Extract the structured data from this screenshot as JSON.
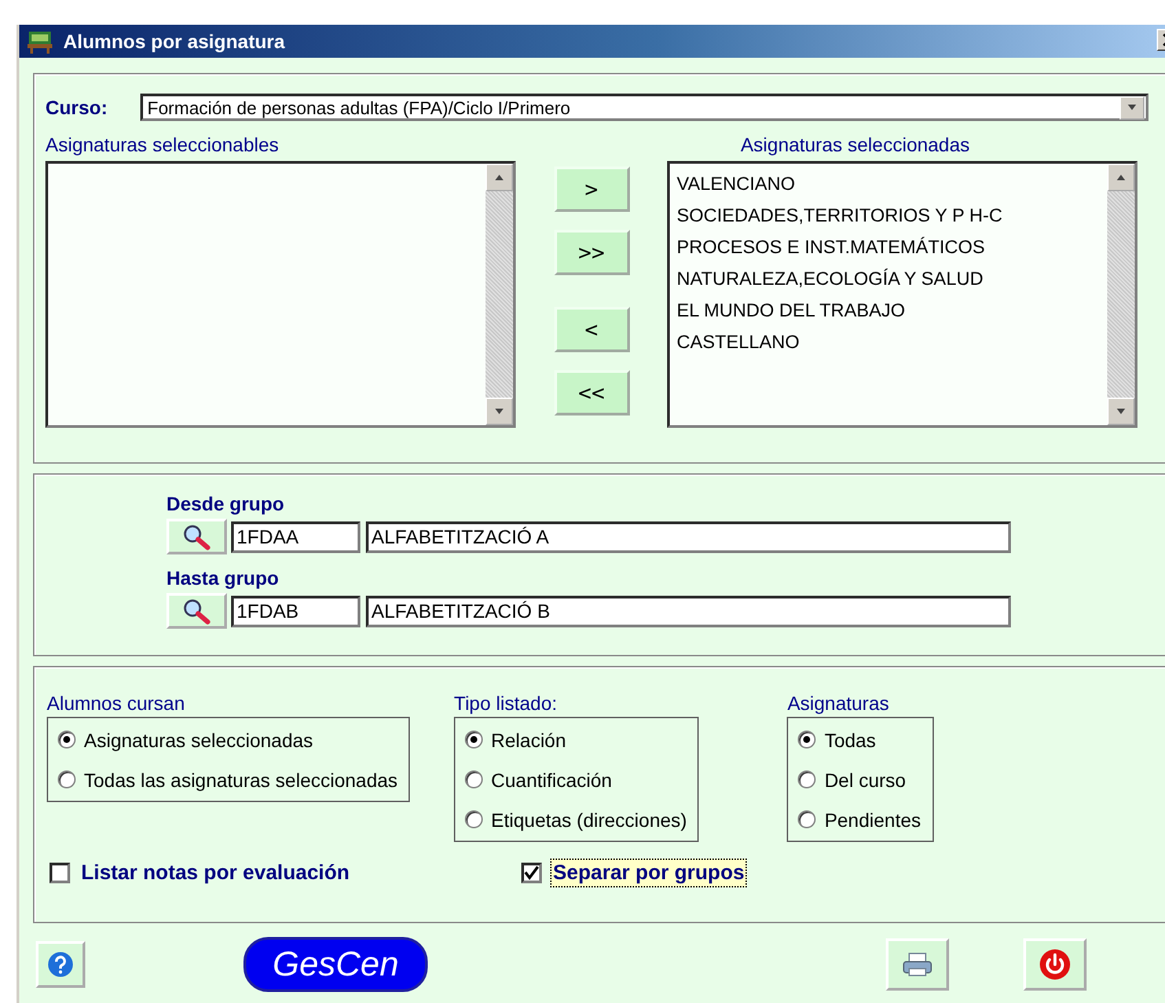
{
  "window": {
    "title": "Alumnos por asignatura"
  },
  "course": {
    "label": "Curso:",
    "value": "Formación de personas adultas (FPA)/Ciclo I/Primero"
  },
  "available": {
    "label": "Asignaturas seleccionables"
  },
  "selected_list": {
    "label": "Asignaturas seleccionadas",
    "items": [
      "VALENCIANO",
      "SOCIEDADES,TERRITORIOS Y P H-C",
      "PROCESOS E INST.MATEMÁTICOS",
      "NATURALEZA,ECOLOGÍA Y SALUD",
      "EL MUNDO DEL TRABAJO",
      "CASTELLANO"
    ]
  },
  "move_buttons": [
    ">",
    ">>",
    "<",
    "<<"
  ],
  "groups": [
    {
      "label": "Desde grupo",
      "code": "1FDAA",
      "name": "ALFABETITZACIÓ A"
    },
    {
      "label": "Hasta grupo",
      "code": "1FDAB",
      "name": "ALFABETITZACIÓ B"
    }
  ],
  "option_groups": [
    {
      "label": "Alumnos cursan",
      "options": [
        {
          "label": "Asignaturas seleccionadas",
          "selected": true
        },
        {
          "label": "Todas las asignaturas seleccionadas",
          "selected": false
        }
      ]
    },
    {
      "label": "Tipo listado:",
      "options": [
        {
          "label": "Relación",
          "selected": true
        },
        {
          "label": "Cuantificación",
          "selected": false
        },
        {
          "label": "Etiquetas (direcciones)",
          "selected": false
        }
      ]
    },
    {
      "label": "Asignaturas",
      "options": [
        {
          "label": "Todas",
          "selected": true
        },
        {
          "label": "Del curso",
          "selected": false
        },
        {
          "label": "Pendientes",
          "selected": false
        }
      ]
    }
  ],
  "checkboxes": [
    {
      "label": "Listar notas por evaluación",
      "checked": false,
      "focused": false
    },
    {
      "label": "Separar por grupos",
      "checked": true,
      "focused": true
    }
  ],
  "logo": "GesCen"
}
